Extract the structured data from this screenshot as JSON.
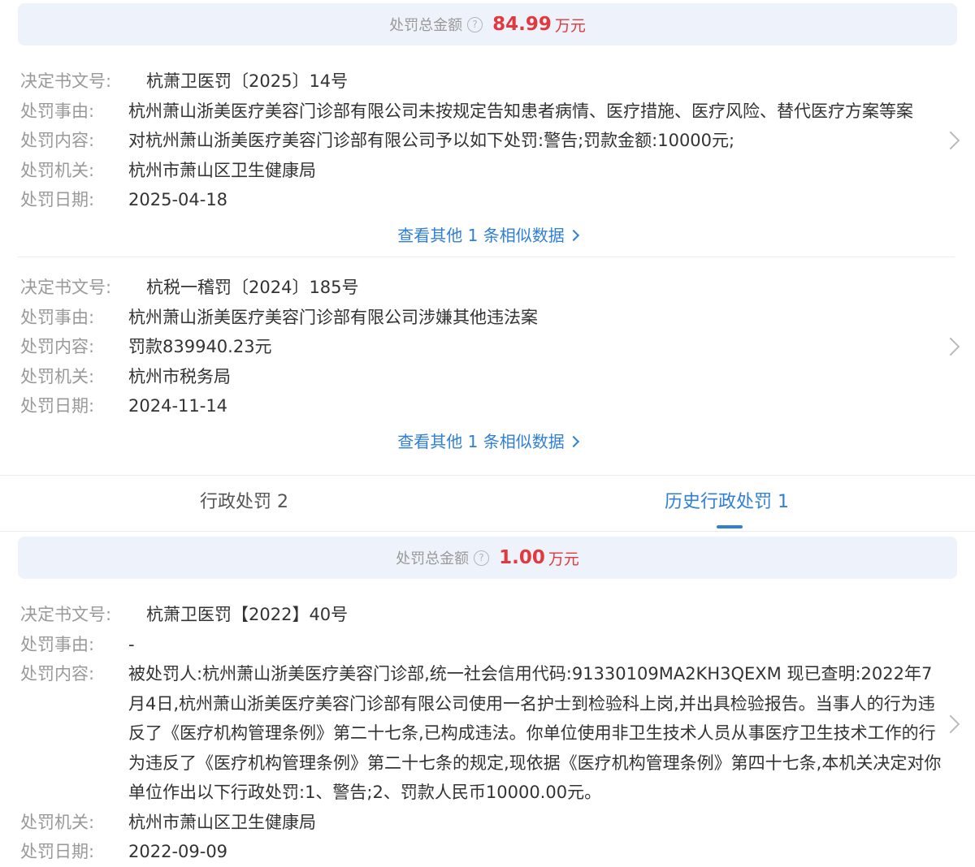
{
  "summary1": {
    "label": "处罚总金额",
    "help_icon": "?",
    "amount": "84.99",
    "unit": "万元"
  },
  "record1": {
    "doc_no_label": "决定书文号:",
    "doc_no": "杭萧卫医罚〔2025〕14号",
    "reason_label": "处罚事由:",
    "reason": "杭州萧山浙美医疗美容门诊部有限公司未按规定告知患者病情、医疗措施、医疗风险、替代医疗方案等案",
    "content_label": "处罚内容:",
    "content": "对杭州萧山浙美医疗美容门诊部有限公司予以如下处罚:警告;罚款金额:10000元;",
    "org_label": "处罚机关:",
    "org": "杭州市萧山区卫生健康局",
    "date_label": "处罚日期:",
    "date": "2025-04-18",
    "more_label": "查看其他 1 条相似数据"
  },
  "record2": {
    "doc_no_label": "决定书文号:",
    "doc_no": "杭税一稽罚〔2024〕185号",
    "reason_label": "处罚事由:",
    "reason": "杭州萧山浙美医疗美容门诊部有限公司涉嫌其他违法案",
    "content_label": "处罚内容:",
    "content": "罚款839940.23元",
    "org_label": "处罚机关:",
    "org": "杭州市税务局",
    "date_label": "处罚日期:",
    "date": "2024-11-14",
    "more_label": "查看其他 1 条相似数据"
  },
  "tabs": {
    "admin_label": "行政处罚 2",
    "history_label": "历史行政处罚 1",
    "active": "history"
  },
  "summary2": {
    "label": "处罚总金额",
    "help_icon": "?",
    "amount": "1.00",
    "unit": "万元"
  },
  "record3": {
    "doc_no_label": "决定书文号:",
    "doc_no": "杭萧卫医罚【2022】40号",
    "reason_label": "处罚事由:",
    "reason": "-",
    "content_label": "处罚内容:",
    "content": "被处罚人:杭州萧山浙美医疗美容门诊部,统一社会信用代码:91330109MA2KH3QEXM 现已查明:2022年7月4日,杭州萧山浙美医疗美容门诊部有限公司使用一名护士到检验科上岗,并出具检验报告。当事人的行为违反了《医疗机构管理条例》第二十七条,已构成违法。你单位使用非卫生技术人员从事医疗卫生技术工作的行为违反了《医疗机构管理条例》第二十七条的规定,现依据《医疗机构管理条例》第四十七条,本机关决定对你单位作出以下行政处罚:1、警告;2、罚款人民币10000.00元。",
    "org_label": "处罚机关:",
    "org": "杭州市萧山区卫生健康局",
    "date_label": "处罚日期:",
    "date": "2022-09-09"
  },
  "colors": {
    "accent": "#2f7fd6",
    "amount": "#e0393e",
    "summary_bg": "#eef3fb",
    "label": "#999999"
  }
}
